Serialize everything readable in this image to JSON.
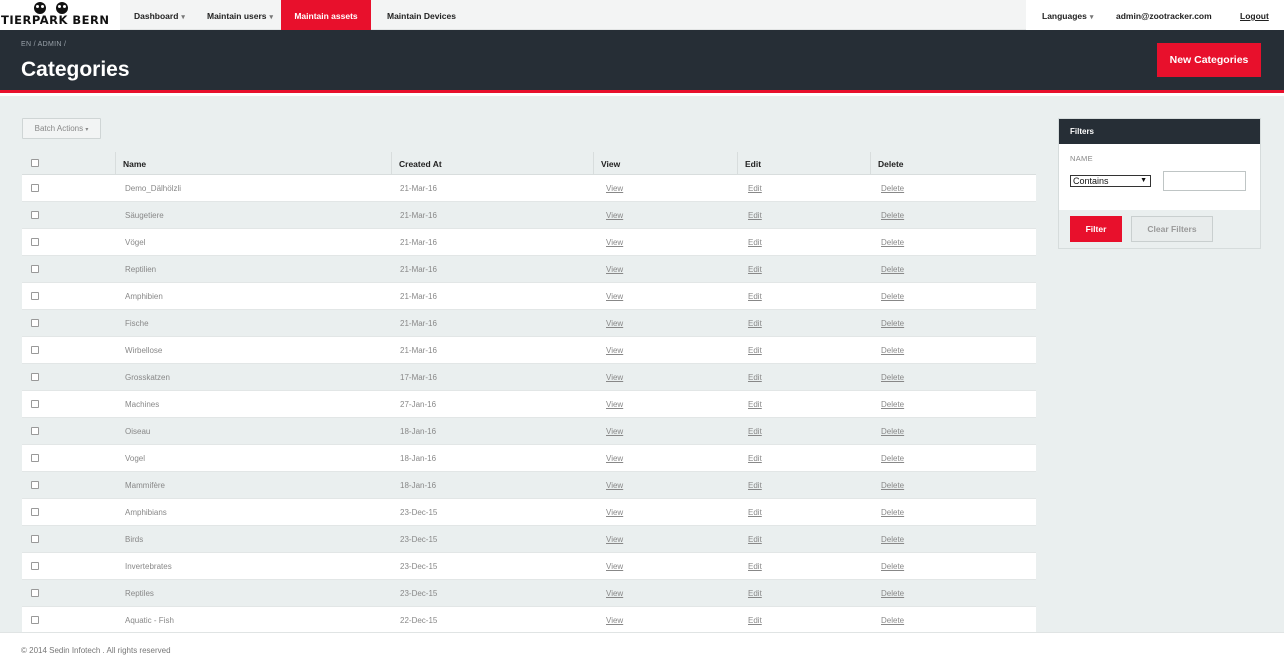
{
  "brand": {
    "name": "TIERPARK BERN"
  },
  "nav": {
    "items": [
      {
        "label": "Dashboard",
        "has_menu": true
      },
      {
        "label": "Maintain users",
        "has_menu": true
      },
      {
        "label": "Maintain assets",
        "has_menu": false,
        "active": true
      },
      {
        "label": "Maintain Devices",
        "has_menu": false
      }
    ],
    "languages": "Languages",
    "user_email": "admin@zootracker.com",
    "logout": "Logout"
  },
  "header": {
    "breadcrumb": "EN / ADMIN /",
    "title": "Categories",
    "new_button": "New Categories"
  },
  "batch_actions": "Batch Actions",
  "table": {
    "columns": [
      "Name",
      "Created At",
      "View",
      "Edit",
      "Delete"
    ],
    "rows": [
      {
        "name": "Demo_Dälhölzli",
        "created": "21-Mar-16",
        "view": "View",
        "edit": "Edit",
        "delete": "Delete"
      },
      {
        "name": "Säugetiere",
        "created": "21-Mar-16",
        "view": "View",
        "edit": "Edit",
        "delete": "Delete"
      },
      {
        "name": "Vögel",
        "created": "21-Mar-16",
        "view": "View",
        "edit": "Edit",
        "delete": "Delete"
      },
      {
        "name": "Reptilien",
        "created": "21-Mar-16",
        "view": "View",
        "edit": "Edit",
        "delete": "Delete"
      },
      {
        "name": "Amphibien",
        "created": "21-Mar-16",
        "view": "View",
        "edit": "Edit",
        "delete": "Delete"
      },
      {
        "name": "Fische",
        "created": "21-Mar-16",
        "view": "View",
        "edit": "Edit",
        "delete": "Delete"
      },
      {
        "name": "Wirbellose",
        "created": "21-Mar-16",
        "view": "View",
        "edit": "Edit",
        "delete": "Delete"
      },
      {
        "name": "Grosskatzen",
        "created": "17-Mar-16",
        "view": "View",
        "edit": "Edit",
        "delete": "Delete"
      },
      {
        "name": "Machines",
        "created": "27-Jan-16",
        "view": "View",
        "edit": "Edit",
        "delete": "Delete"
      },
      {
        "name": "Oiseau",
        "created": "18-Jan-16",
        "view": "View",
        "edit": "Edit",
        "delete": "Delete"
      },
      {
        "name": "Vogel",
        "created": "18-Jan-16",
        "view": "View",
        "edit": "Edit",
        "delete": "Delete"
      },
      {
        "name": "Mammifère",
        "created": "18-Jan-16",
        "view": "View",
        "edit": "Edit",
        "delete": "Delete"
      },
      {
        "name": "Amphibians",
        "created": "23-Dec-15",
        "view": "View",
        "edit": "Edit",
        "delete": "Delete"
      },
      {
        "name": "Birds",
        "created": "23-Dec-15",
        "view": "View",
        "edit": "Edit",
        "delete": "Delete"
      },
      {
        "name": "Invertebrates",
        "created": "23-Dec-15",
        "view": "View",
        "edit": "Edit",
        "delete": "Delete"
      },
      {
        "name": "Reptiles",
        "created": "23-Dec-15",
        "view": "View",
        "edit": "Edit",
        "delete": "Delete"
      },
      {
        "name": "Aquatic - Fish",
        "created": "22-Dec-15",
        "view": "View",
        "edit": "Edit",
        "delete": "Delete"
      }
    ]
  },
  "filters": {
    "title": "Filters",
    "name_label": "NAME",
    "operator": "Contains",
    "value": "",
    "filter_button": "Filter",
    "clear_button": "Clear Filters"
  },
  "footer": {
    "text": "© 2014 Sedin Infotech . All rights reserved"
  },
  "colors": {
    "accent": "#e8102c",
    "dark": "#262e36"
  }
}
